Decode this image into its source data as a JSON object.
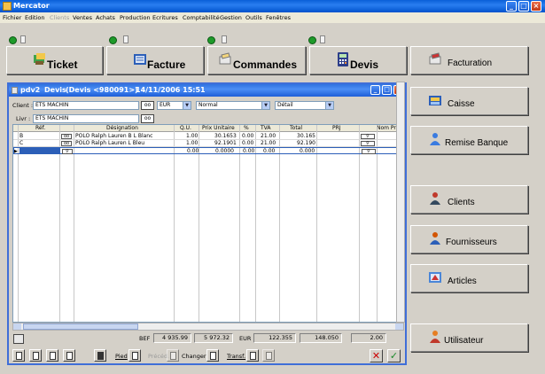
{
  "app": {
    "title": "Mercator"
  },
  "menu": [
    "Fichier",
    "Edition",
    "Clients",
    "Ventes",
    "Achats",
    "Production",
    "Ecritures",
    "Comptabilité",
    "Gestion",
    "Outils",
    "Fenêtres"
  ],
  "nav": {
    "ticket": "Ticket",
    "facture": "Facture",
    "commandes": "Commandes",
    "devis": "Devis"
  },
  "side": {
    "facturation": "Facturation",
    "caisse": "Caisse",
    "remise_banque": "Remise Banque",
    "clients": "Clients",
    "fournisseurs": "Fournisseurs",
    "articles": "Articles",
    "utilisateur": "Utilisateur"
  },
  "doc": {
    "window": "pdv2",
    "type": "Devis",
    "number": "(Devis <980091>)",
    "date": "14/11/2006 15:51",
    "client_label": "Client :",
    "client": "ETS MACHIN",
    "livr_label": "Livr :",
    "livr": "ETS MACHIN",
    "currency": "EUR",
    "tarif": "Normal",
    "mode": "Détail"
  },
  "grid": {
    "headers": [
      "Réf.",
      "Désignation",
      "Q.U.",
      "Prix Unitaire",
      "%",
      "TVA",
      "Total",
      "PRJ",
      "Nom Pro"
    ],
    "rows": [
      {
        "ref": "B",
        "designation": "POLO Ralph Lauren B L Blanc",
        "qu": "1.00",
        "prix": "30.1653",
        "pct": "0.00",
        "tva": "21.00",
        "total": "30.165"
      },
      {
        "ref": "C",
        "designation": "POLO Ralph Lauren L Bleu",
        "qu": "1.00",
        "prix": "92.1901",
        "pct": "0.00",
        "tva": "21.00",
        "total": "92.190"
      },
      {
        "ref": "",
        "designation": "",
        "qu": "0.00",
        "prix": "0.0000",
        "pct": "0.00",
        "tva": "0.00",
        "total": "0.000"
      }
    ]
  },
  "totals": {
    "bef_label": "BEF",
    "bef1": "4 935.99",
    "bef2": "5 972.32",
    "eur_label": "EUR",
    "eur1": "122.355",
    "eur2": "148.050",
    "qty": "2.00"
  },
  "footer": {
    "pied": "Pied",
    "prec": "Précéd.",
    "changer": "Changer",
    "transf": "Transf."
  }
}
